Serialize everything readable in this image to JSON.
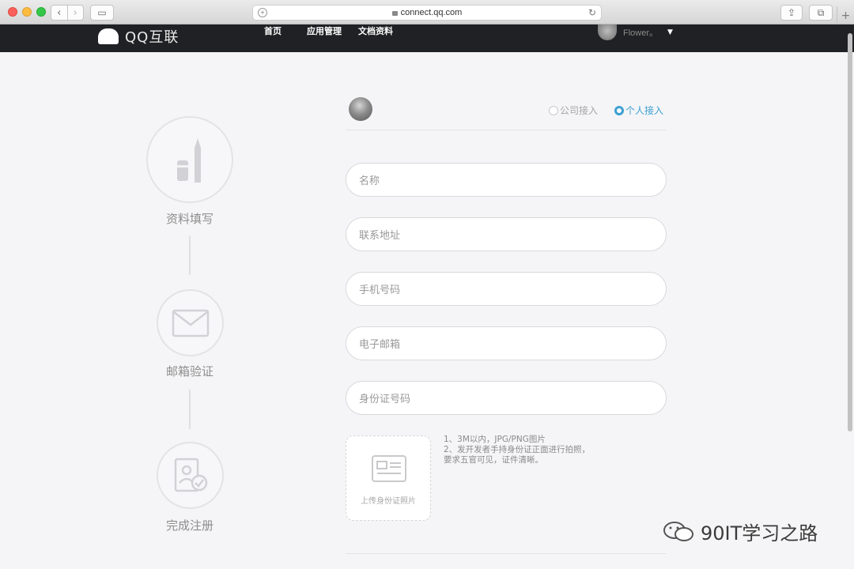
{
  "browser": {
    "url": "connect.qq.com"
  },
  "header": {
    "logo_text": "QQ互联",
    "nav": [
      "首页",
      "应用管理",
      "文档资料"
    ],
    "username": "Flower。"
  },
  "steps": [
    {
      "label": "资料填写",
      "icon": "pen-icon"
    },
    {
      "label": "邮箱验证",
      "icon": "envelope-icon"
    },
    {
      "label": "完成注册",
      "icon": "id-check-icon"
    }
  ],
  "account_type": {
    "options": [
      "公司接入",
      "个人接入"
    ],
    "selected": "个人接入"
  },
  "form": {
    "fields": [
      {
        "placeholder": "名称"
      },
      {
        "placeholder": "联系地址"
      },
      {
        "placeholder": "手机号码"
      },
      {
        "placeholder": "电子邮箱"
      },
      {
        "placeholder": "身份证号码"
      }
    ],
    "upload_label": "上传身份证照片",
    "notes": [
      "1、3M以内，JPG/PNG图片",
      "2、发开发者手持身份证正面进行拍照，",
      "要求五官可见，证件清晰。"
    ]
  },
  "watermark": "90IT学习之路",
  "colors": {
    "accent": "#3da0d1",
    "header_bg": "#1f2124"
  }
}
